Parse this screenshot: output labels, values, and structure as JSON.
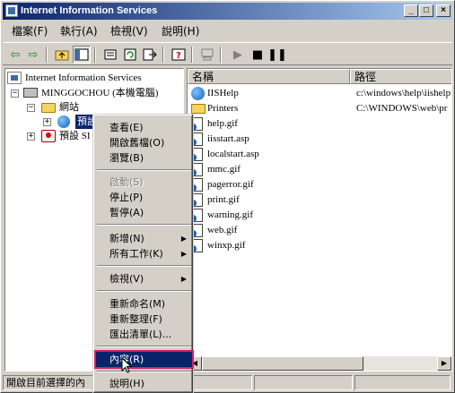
{
  "window": {
    "title": "Internet Information Services",
    "controls": {
      "minimize": "_",
      "maximize": "□",
      "close": "×"
    }
  },
  "menubar": [
    {
      "label": "檔案(F)"
    },
    {
      "label": "執行(A)"
    },
    {
      "label": "檢視(V)"
    },
    {
      "label": "說明(H)"
    }
  ],
  "tree": {
    "root": "Internet Information Services",
    "computer": "MINGGOCHOU (本機電腦)",
    "websites": "網站",
    "default_site": "預設",
    "default_smtp": "預設 SI"
  },
  "list": {
    "columns": [
      "名稱",
      "路徑"
    ],
    "rows": [
      {
        "name": "IISHelp",
        "path": "c:\\windows\\help\\iishelp",
        "icon": "globe-icon"
      },
      {
        "name": "Printers",
        "path": "C:\\WINDOWS\\web\\pr",
        "icon": "folder-icon"
      },
      {
        "name": "help.gif",
        "path": "",
        "icon": "file-icon"
      },
      {
        "name": "iisstart.asp",
        "path": "",
        "icon": "file-icon"
      },
      {
        "name": "localstart.asp",
        "path": "",
        "icon": "file-icon"
      },
      {
        "name": "mmc.gif",
        "path": "",
        "icon": "file-icon"
      },
      {
        "name": "pagerror.gif",
        "path": "",
        "icon": "file-icon"
      },
      {
        "name": "print.gif",
        "path": "",
        "icon": "file-icon"
      },
      {
        "name": "warning.gif",
        "path": "",
        "icon": "file-icon"
      },
      {
        "name": "web.gif",
        "path": "",
        "icon": "file-icon"
      },
      {
        "name": "winxp.gif",
        "path": "",
        "icon": "file-icon"
      }
    ]
  },
  "context_menu": {
    "open_view": "查看(E)",
    "open_file": "開啟舊檔(O)",
    "browse": "瀏覽(B)",
    "start": "啟動(S)",
    "stop": "停止(P)",
    "pause": "暫停(A)",
    "new": "新增(N)",
    "all_tasks": "所有工作(K)",
    "view": "檢視(V)",
    "rename": "重新命名(M)",
    "refresh": "重新整理(F)",
    "export": "匯出清單(L)...",
    "properties": "內容(R)",
    "help": "說明(H)"
  },
  "statusbar": {
    "text": "開啟目前選擇的內"
  },
  "colors": {
    "titlebar_start": "#0a246a",
    "titlebar_end": "#a6caf0",
    "highlight": "#0a246a",
    "highlight_outline": "#e0186c"
  }
}
